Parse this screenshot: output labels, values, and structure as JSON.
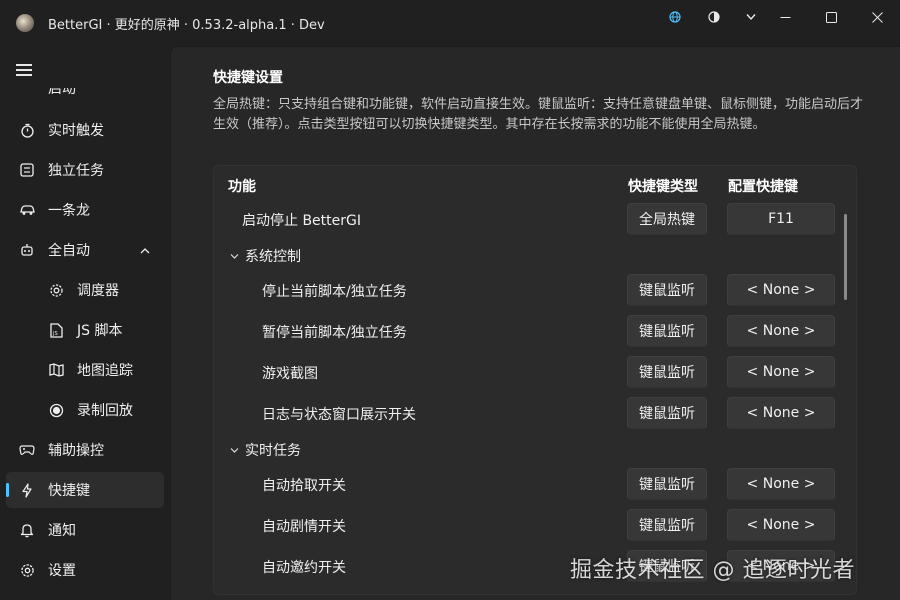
{
  "window": {
    "title": "BetterGI · 更好的原神 · 0.53.2-alpha.1 · Dev",
    "icons": [
      "app-logo-icon",
      "globe-icon",
      "theme-icon",
      "dropdown-icon",
      "minimize-icon",
      "maximize-icon",
      "close-icon"
    ]
  },
  "sidebar": {
    "partial_item": "启动",
    "items": [
      {
        "label": "实时触发",
        "icon": "timer-icon"
      },
      {
        "label": "独立任务",
        "icon": "list-box-icon"
      },
      {
        "label": "一条龙",
        "icon": "car-icon"
      },
      {
        "label": "全自动",
        "icon": "bot-icon"
      },
      {
        "label": "调度器",
        "icon": "gear-icon"
      },
      {
        "label": "JS 脚本",
        "icon": "js-file-icon"
      },
      {
        "label": "地图追踪",
        "icon": "map-icon"
      },
      {
        "label": "录制回放",
        "icon": "record-icon"
      },
      {
        "label": "辅助操控",
        "icon": "gamepad-icon"
      },
      {
        "label": "快捷键",
        "icon": "lightning-icon"
      },
      {
        "label": "通知",
        "icon": "bell-icon"
      },
      {
        "label": "设置",
        "icon": "settings-icon"
      }
    ],
    "active_index": 9
  },
  "main": {
    "title": "快捷键设置",
    "description": "全局热键：只支持组合键和功能键，软件启动直接生效。键鼠监听：支持任意键盘单键、鼠标侧键，功能启动后才生效（推荐）。点击类型按钮可以切换快捷键类型。其中存在长按需求的功能不能使用全局热键。",
    "table": {
      "headers": [
        "功能",
        "快捷键类型",
        "配置快捷键"
      ],
      "rows": [
        {
          "label": "启动停止 BetterGI",
          "type": "全局热键",
          "key": "F11"
        },
        {
          "group": "系统控制"
        },
        {
          "label": "停止当前脚本/独立任务",
          "type": "键鼠监听",
          "key": "< None >"
        },
        {
          "label": "暂停当前脚本/独立任务",
          "type": "键鼠监听",
          "key": "< None >"
        },
        {
          "label": "游戏截图",
          "type": "键鼠监听",
          "key": "< None >"
        },
        {
          "label": "日志与状态窗口展示开关",
          "type": "键鼠监听",
          "key": "< None >"
        },
        {
          "group": "实时任务"
        },
        {
          "label": "自动拾取开关",
          "type": "键鼠监听",
          "key": "< None >"
        },
        {
          "label": "自动剧情开关",
          "type": "键鼠监听",
          "key": "< None >"
        },
        {
          "label": "自动邀约开关",
          "type": "键鼠监听",
          "key": "< None >"
        }
      ]
    }
  },
  "watermark": "掘金技术社区 @ 追逐时光者",
  "colors": {
    "accent": "#4cc2ff",
    "background": "#202020",
    "panel": "#272727",
    "card": "#2b2b2b",
    "button": "#373737"
  }
}
